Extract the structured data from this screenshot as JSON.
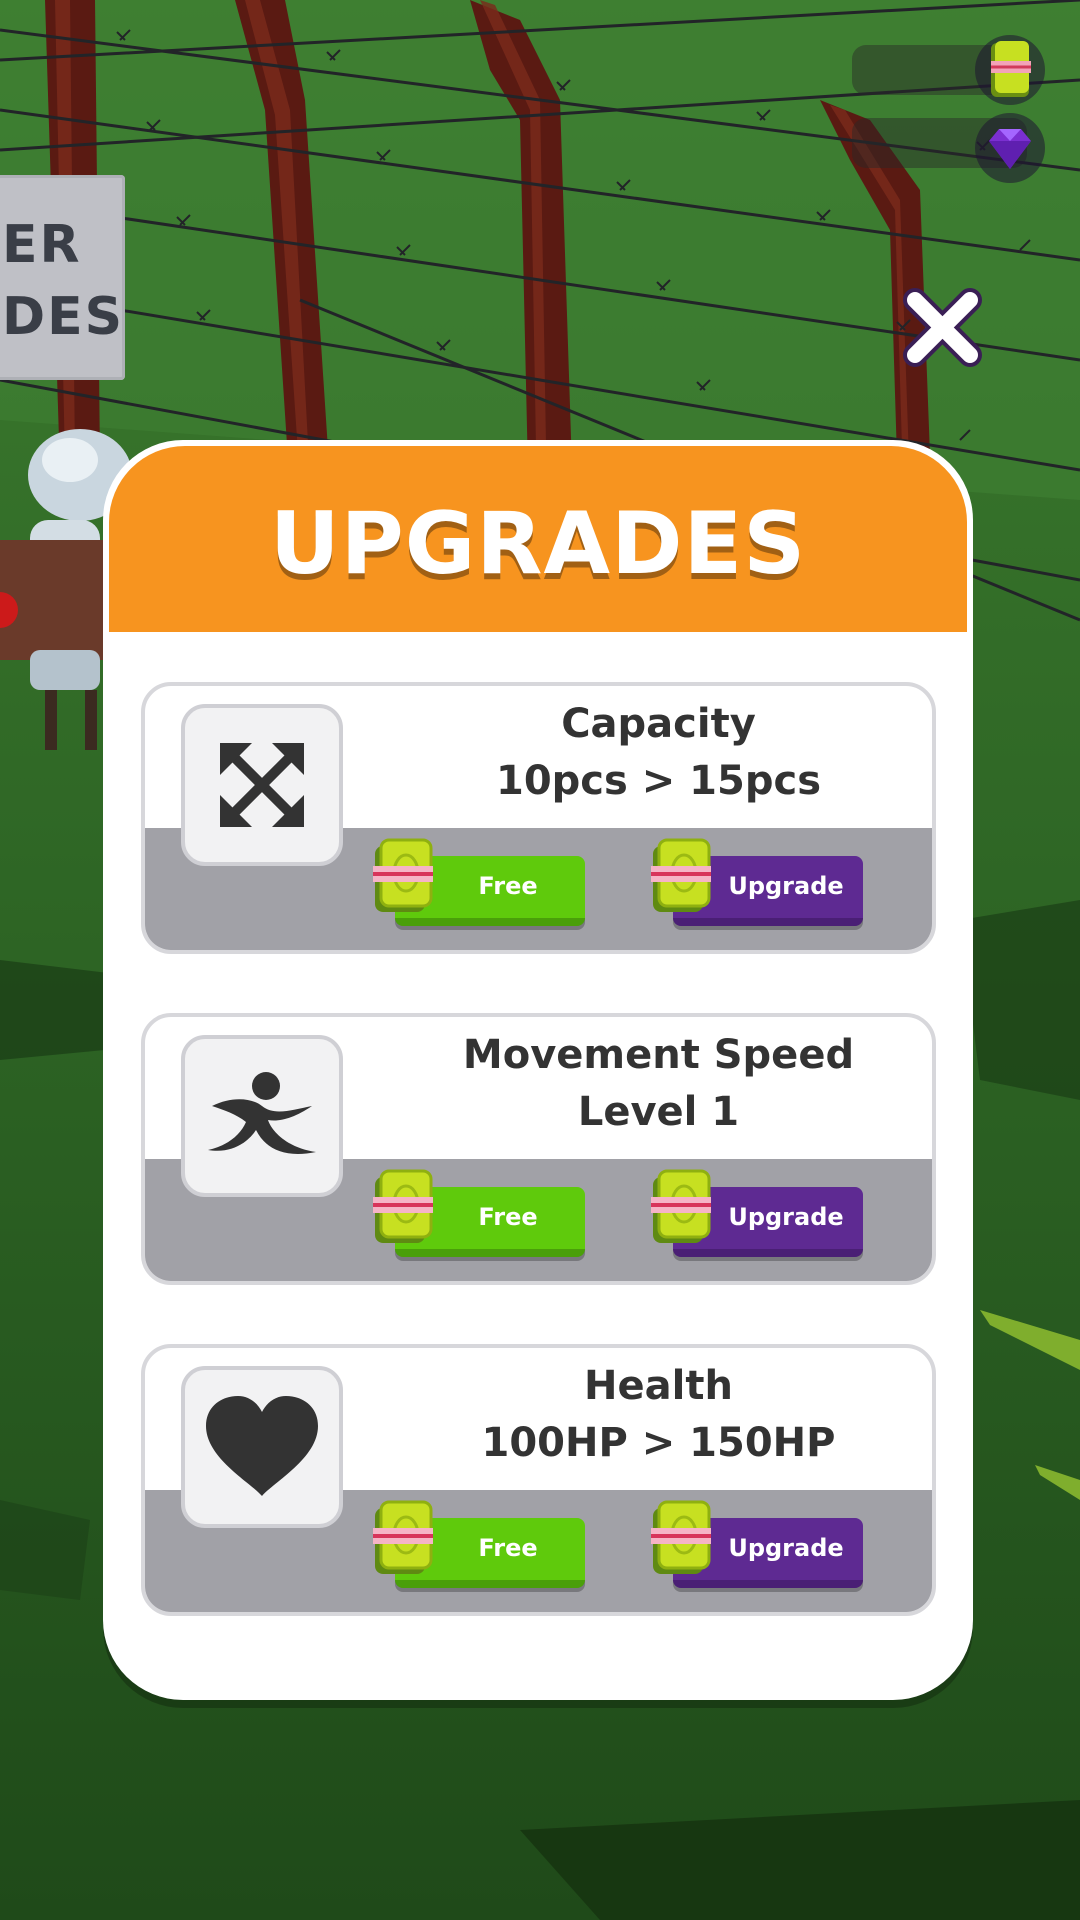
{
  "hud": {
    "cash_icon": "cash-stack-icon",
    "gem_icon": "purple-gem-icon"
  },
  "background": {
    "sign_line1": "ER",
    "sign_line2": "DES"
  },
  "panel": {
    "title": "UPGRADES",
    "close_icon": "close-icon"
  },
  "cards": [
    {
      "title": "Capacity",
      "subtitle": "10pcs > 15pcs",
      "icon": "expand-arrows-icon",
      "free_label": "Free",
      "upgrade_label": "Upgrade"
    },
    {
      "title": "Movement Speed",
      "subtitle": "Level 1",
      "icon": "running-figure-icon",
      "free_label": "Free",
      "upgrade_label": "Upgrade"
    },
    {
      "title": "Health",
      "subtitle": "100HP > 150HP",
      "icon": "heart-icon",
      "free_label": "Free",
      "upgrade_label": "Upgrade"
    }
  ],
  "colors": {
    "header_orange": "#f7941f",
    "free_green": "#5fca0c",
    "upgrade_purple": "#5e2a92",
    "grass": "#2f6a26"
  }
}
